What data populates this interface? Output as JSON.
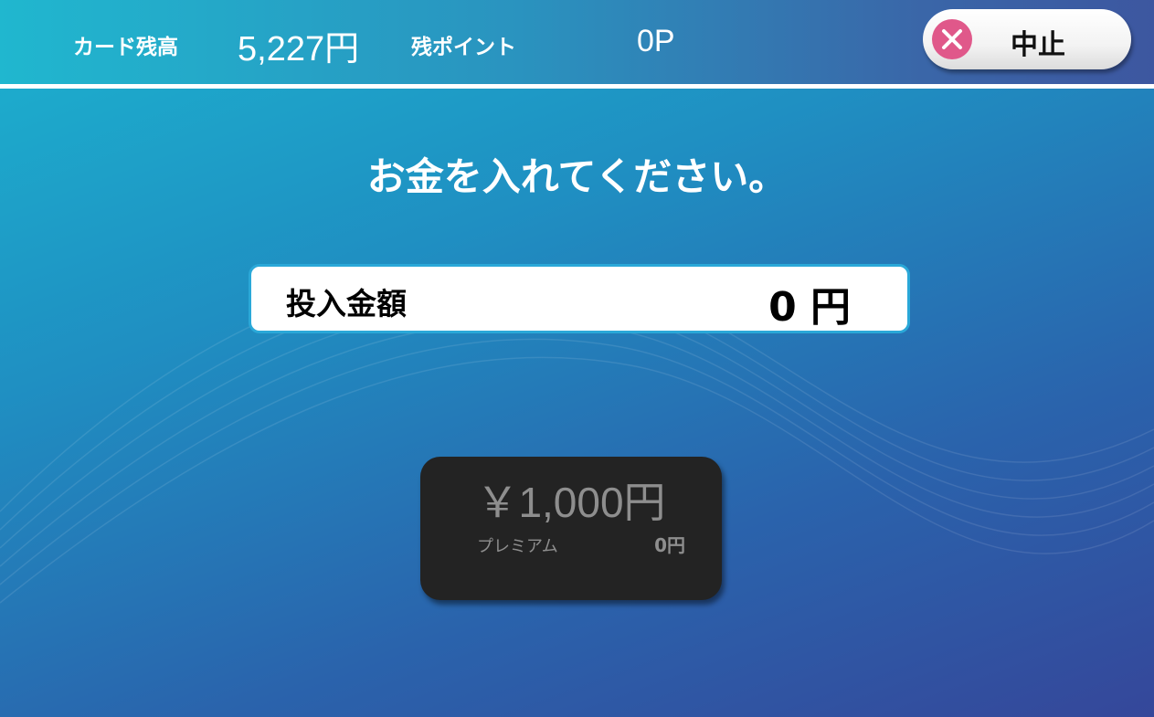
{
  "header": {
    "card_balance_label": "カード残高",
    "card_balance_value": "5,227円",
    "points_label": "残ポイント",
    "points_value": "0P",
    "cancel_label": "中止",
    "cancel_icon": "close-circle-icon"
  },
  "main": {
    "instruction": "お金を入れてください。",
    "amount_label": "投入金額",
    "amount_value": "0 円"
  },
  "denomination": {
    "amount": "￥1,000円",
    "premium_label": "プレミアム",
    "premium_value": "0円"
  },
  "colors": {
    "cancel_icon": "#e0588a",
    "amount_border": "#2aa8d8",
    "denomination_bg": "#232323",
    "denomination_text": "#8e8e8e"
  }
}
